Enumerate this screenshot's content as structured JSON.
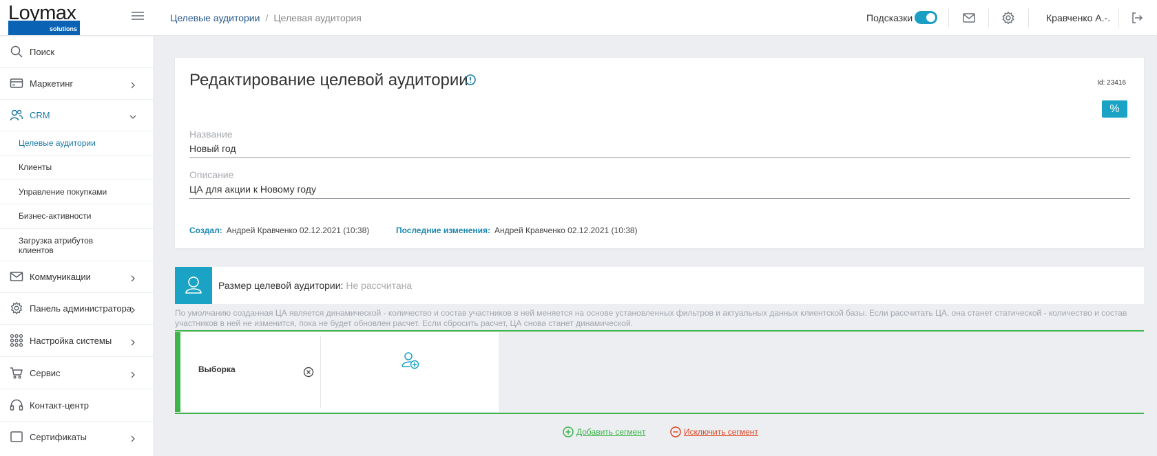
{
  "header": {
    "logo_main": "Loymax",
    "logo_sub": "solutions",
    "breadcrumb": [
      "Целевые аудитории",
      "Целевая аудитория"
    ],
    "breadcrumb_sep": "/",
    "tips_label": "Подсказки",
    "tips_enabled": true,
    "user_name": "Кравченко А.-.",
    "accent": "#1aa3c4",
    "icons": [
      "menu-icon",
      "mail-icon",
      "gear-icon",
      "logout-icon"
    ]
  },
  "sidebar": {
    "items": [
      {
        "label": "Поиск",
        "icon": "search-icon"
      },
      {
        "label": "Маркетинг",
        "icon": "card-icon"
      },
      {
        "label": "CRM",
        "icon": "users-icon"
      },
      {
        "label": "Коммуникации",
        "icon": "mail-icon"
      },
      {
        "label": "Панель администратора",
        "icon": "gear-icon"
      },
      {
        "label": "Настройка системы",
        "icon": "grid-icon"
      },
      {
        "label": "Сервис",
        "icon": "cart-icon"
      },
      {
        "label": "Контакт-центр",
        "icon": "headset-icon"
      },
      {
        "label": "Сертификаты",
        "icon": "certificate-icon"
      }
    ],
    "crm_sub": [
      {
        "label": "Целевые аудитории"
      },
      {
        "label": "Клиенты"
      },
      {
        "label": "Управление покупками"
      },
      {
        "label": "Бизнес-активности"
      },
      {
        "label": "Загрузка атрибутов клиентов"
      }
    ]
  },
  "main": {
    "title": "Редактирование целевой аудитории",
    "id_text": "Id: 23416",
    "pct_symbol": "%",
    "name_label": "Название",
    "name_value": "Новый год",
    "desc_label": "Описание",
    "desc_value": "ЦА для акции к Новому году",
    "created_label": "Создал:",
    "created_value": "Андрей Кравченко 02.12.2021 (10:38)",
    "modified_label": "Последние изменения:",
    "modified_value": "Андрей Кравченко 02.12.2021 (10:38)"
  },
  "size": {
    "label": "Размер целевой аудитории:",
    "value": "Не рассчитана",
    "note": "По умолчанию созданная ЦА является динамической - количество и состав участников в ней меняется на основе установленных фильтров и актуальных данных клиентской базы. Если рассчитать ЦА, она станет статической - количество и состав участников в ней не изменится, пока не будет обновлен расчет. Если сбросить расчет, ЦА снова станет динамической."
  },
  "segment": {
    "title": "Выборка",
    "add_segment": "Добавить сегмент",
    "exclude_segment": "Исключить сегмент",
    "add_color": "#3db54a",
    "exclude_color": "#e0451f"
  }
}
